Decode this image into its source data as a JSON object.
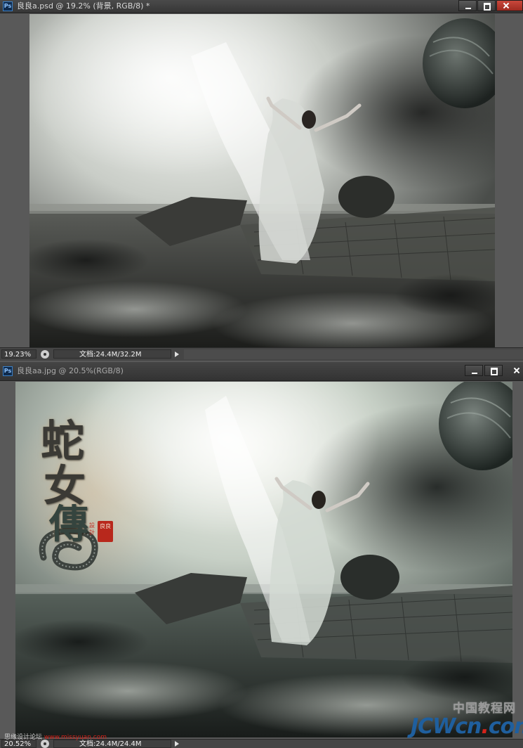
{
  "windows": [
    {
      "app_icon": "Ps",
      "title": "良良a.psd @ 19.2% (背景, RGB/8) *",
      "active": true,
      "status": {
        "zoom": "19.23%",
        "doc_info": "文档:24.4M/32.2M"
      },
      "icons": [
        "photoshop-icon",
        "minimize-icon",
        "maximize-icon",
        "close-icon",
        "status-menu-icon",
        "status-arrow-icon"
      ]
    },
    {
      "app_icon": "Ps",
      "title": "良良aa.jpg @ 20.5%(RGB/8)",
      "active": false,
      "status": {
        "zoom": "20.52%",
        "doc_info": "文档:24.4M/24.4M"
      },
      "artwork": {
        "calligraphy": [
          "蛇",
          "女",
          "傳"
        ],
        "seal_text": "良良",
        "seal_side": "設計"
      },
      "icons": [
        "photoshop-icon",
        "minimize-icon",
        "maximize-icon",
        "close-icon",
        "status-menu-icon",
        "status-arrow-icon"
      ]
    }
  ],
  "watermark": {
    "site_cn": "中国教程网",
    "site_en_a": "JCWcn",
    "site_en_dot": ".",
    "site_en_b": "com"
  },
  "forum_watermark": {
    "prefix": "思缘设计论坛",
    "url": "www.missyuan.com"
  },
  "colors": {
    "titlebar": "#3b3b3b",
    "close_button": "#c9483c",
    "status_bar": "#454545",
    "watermark_blue": "#1f5f9e",
    "watermark_red": "#d4231a"
  }
}
